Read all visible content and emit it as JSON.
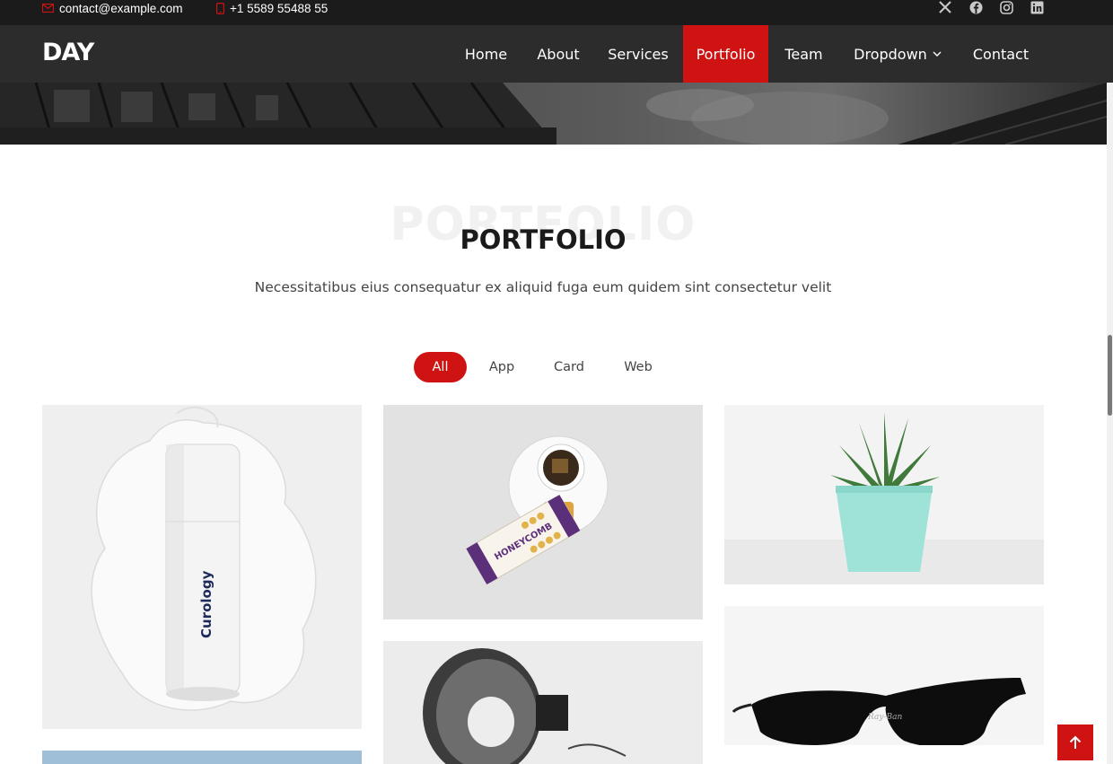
{
  "topbar": {
    "email": "contact@example.com",
    "phone": "+1 5589 55488 55",
    "social": [
      "x-icon",
      "facebook-icon",
      "instagram-icon",
      "linkedin-icon"
    ]
  },
  "header": {
    "logo": "DAY",
    "nav": [
      {
        "label": "Home"
      },
      {
        "label": "About"
      },
      {
        "label": "Services"
      },
      {
        "label": "Portfolio",
        "active": true
      },
      {
        "label": "Team"
      },
      {
        "label": "Dropdown"
      },
      {
        "label": "Contact"
      }
    ]
  },
  "section": {
    "bg_title": "PORTFOLIO",
    "title": "PORTFOLIO",
    "description": "Necessitatibus eius consequatur ex aliquid fuga eum quidem sint consectetur velit"
  },
  "filters": [
    {
      "label": "All",
      "active": true
    },
    {
      "label": "App"
    },
    {
      "label": "Card"
    },
    {
      "label": "Web"
    }
  ],
  "portfolio": {
    "product_label": "Curology",
    "tube_label": "HONEYCOMB",
    "glasses_label": "Ray-Ban"
  },
  "colors": {
    "accent": "#cf1312",
    "topbar": "#1b1b1b",
    "header": "#2c2c2c"
  }
}
